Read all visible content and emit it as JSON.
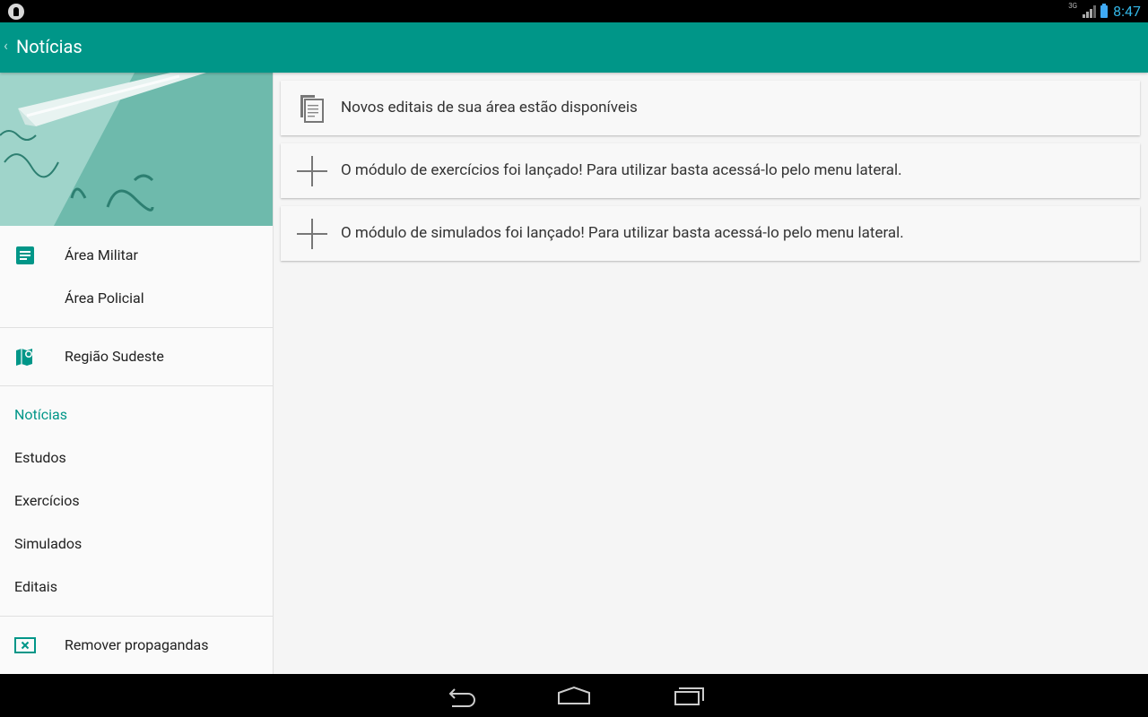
{
  "status_bar": {
    "time": "8:47",
    "network": "3G"
  },
  "app_bar": {
    "title": "Notícias"
  },
  "drawer": {
    "area_items": [
      {
        "label": "Área Militar",
        "icon": "document-icon"
      },
      {
        "label": "Área Policial"
      }
    ],
    "region": {
      "label": "Região Sudeste",
      "icon": "map-pin-icon"
    },
    "nav_items": [
      {
        "label": "Notícias",
        "active": true
      },
      {
        "label": "Estudos"
      },
      {
        "label": "Exercícios"
      },
      {
        "label": "Simulados"
      },
      {
        "label": "Editais"
      }
    ],
    "remove_ads": {
      "label": "Remover propagandas",
      "icon": "close-box-icon"
    }
  },
  "news": [
    {
      "icon": "copy-document-icon",
      "text": "Novos editais de sua área estão disponíveis"
    },
    {
      "icon": "plus-icon",
      "text": "O módulo de exercícios foi lançado! Para utilizar basta acessá-lo pelo menu lateral."
    },
    {
      "icon": "plus-icon",
      "text": "O módulo de simulados foi lançado! Para utilizar basta acessá-lo pelo menu lateral."
    }
  ],
  "colors": {
    "primary": "#009688",
    "status_bar": "#000000",
    "clock": "#33b5e5"
  }
}
